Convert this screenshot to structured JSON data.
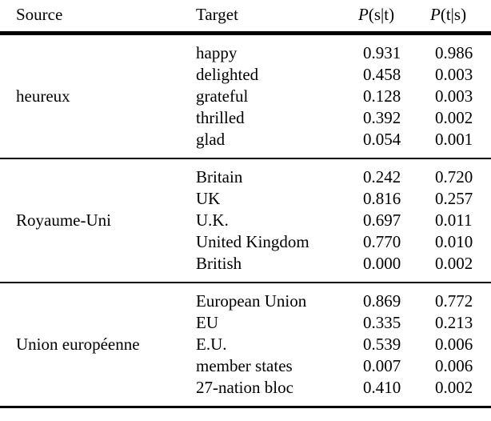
{
  "table": {
    "columns": {
      "source": "Source",
      "target": "Target",
      "p_s_given_t": "P(s|t)",
      "p_t_given_s": "P(t|s)",
      "p_s_given_t_parts": {
        "p": "P",
        "open": "(",
        "num": "s",
        "bar": "|",
        "den": "t",
        "close": ")"
      },
      "p_t_given_s_parts": {
        "p": "P",
        "open": "(",
        "num": "t",
        "bar": "|",
        "den": "s",
        "close": ")"
      }
    },
    "blocks": [
      {
        "source": "heureux",
        "rows": [
          {
            "target": "happy",
            "p_st": "0.931",
            "p_ts": "0.986"
          },
          {
            "target": "delighted",
            "p_st": "0.458",
            "p_ts": "0.003"
          },
          {
            "target": "grateful",
            "p_st": "0.128",
            "p_ts": "0.003"
          },
          {
            "target": "thrilled",
            "p_st": "0.392",
            "p_ts": "0.002"
          },
          {
            "target": "glad",
            "p_st": "0.054",
            "p_ts": "0.001"
          }
        ]
      },
      {
        "source": "Royaume-Uni",
        "rows": [
          {
            "target": "Britain",
            "p_st": "0.242",
            "p_ts": "0.720"
          },
          {
            "target": "UK",
            "p_st": "0.816",
            "p_ts": "0.257"
          },
          {
            "target": "U.K.",
            "p_st": "0.697",
            "p_ts": "0.011"
          },
          {
            "target": "United Kingdom",
            "p_st": "0.770",
            "p_ts": "0.010"
          },
          {
            "target": "British",
            "p_st": "0.000",
            "p_ts": "0.002"
          }
        ]
      },
      {
        "source": "Union européenne",
        "rows": [
          {
            "target": "European Union",
            "p_st": "0.869",
            "p_ts": "0.772"
          },
          {
            "target": "EU",
            "p_st": "0.335",
            "p_ts": "0.213"
          },
          {
            "target": "E.U.",
            "p_st": "0.539",
            "p_ts": "0.006"
          },
          {
            "target": "member states",
            "p_st": "0.007",
            "p_ts": "0.006"
          },
          {
            "target": "27-nation bloc",
            "p_st": "0.410",
            "p_ts": "0.002"
          }
        ]
      }
    ]
  }
}
